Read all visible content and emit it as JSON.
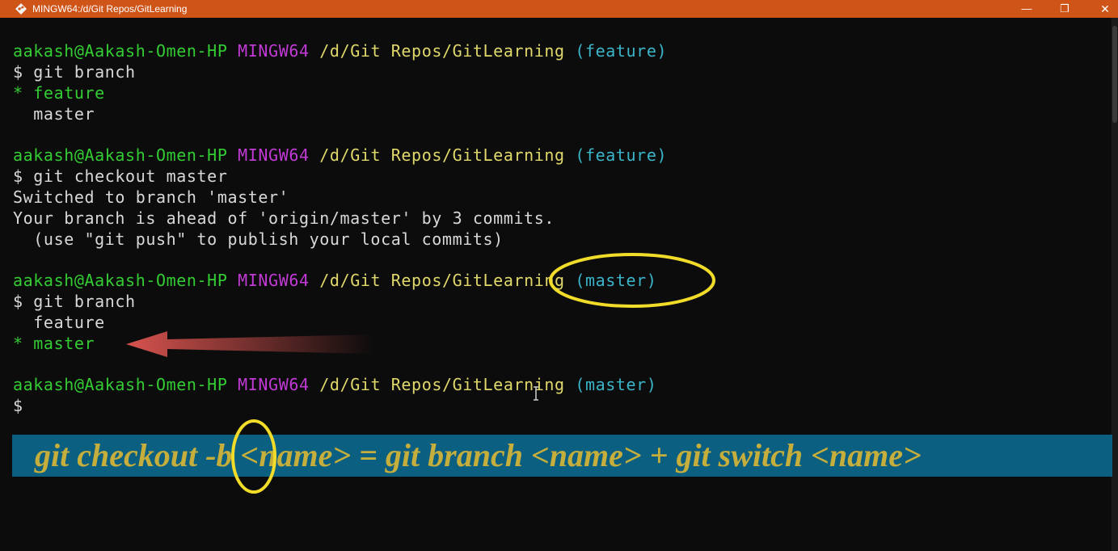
{
  "window": {
    "title": "MINGW64:/d/Git Repos/GitLearning",
    "controls": {
      "minimize": "—",
      "maximize": "❐",
      "close": "✕"
    }
  },
  "terminal": {
    "prompts": [
      {
        "user": "aakash@Aakash-Omen-HP",
        "shell": "MINGW64",
        "path": "/d/Git Repos/GitLearning",
        "branch": "(feature)"
      },
      {
        "user": "aakash@Aakash-Omen-HP",
        "shell": "MINGW64",
        "path": "/d/Git Repos/GitLearning",
        "branch": "(feature)"
      },
      {
        "user": "aakash@Aakash-Omen-HP",
        "shell": "MINGW64",
        "path": "/d/Git Repos/GitLearning",
        "branch": "(master)"
      },
      {
        "user": "aakash@Aakash-Omen-HP",
        "shell": "MINGW64",
        "path": "/d/Git Repos/GitLearning",
        "branch": "(master)"
      }
    ],
    "commands": [
      "$ git branch",
      "$ git checkout master",
      "$ git branch",
      "$"
    ],
    "output": {
      "branch_list_1": [
        "* feature",
        "  master"
      ],
      "checkout_msgs": [
        "Switched to branch 'master'",
        "Your branch is ahead of 'origin/master' by 3 commits.",
        "  (use \"git push\" to publish your local commits)"
      ],
      "branch_list_2": [
        "  feature",
        "* master"
      ]
    }
  },
  "banner": {
    "text": "git checkout -b <name> = git branch <name> + git switch <name>"
  },
  "colors": {
    "titlebar": "#cf5418",
    "prompt_user": "#33cc33",
    "prompt_shell": "#c23ad6",
    "prompt_path": "#e0d86a",
    "prompt_branch": "#3bb5c9",
    "annotation_circle": "#f2dc2a",
    "annotation_arrow": "#d9534f",
    "banner_bg": "#0b5f80",
    "banner_text": "#c6ae3c"
  }
}
